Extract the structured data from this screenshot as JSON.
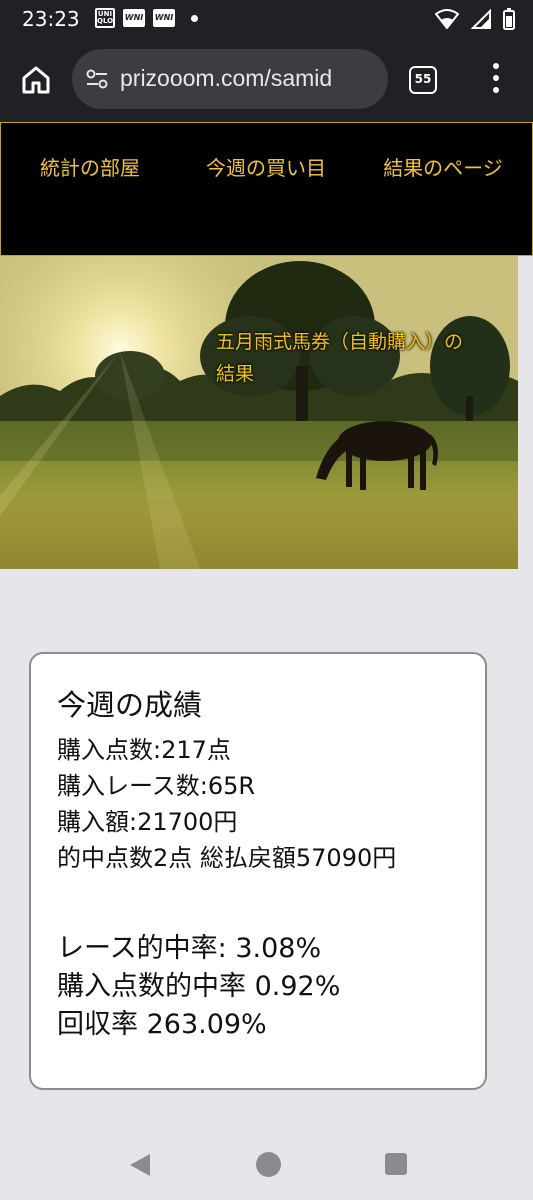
{
  "status_bar": {
    "time": "23:23",
    "uniqlo_badge": "UNI QLO",
    "wnl_badge_1": "WNI",
    "wnl_badge_2": "WNI"
  },
  "browser": {
    "url": "prizooom.com/samid",
    "tab_count": "55"
  },
  "nav": {
    "items": [
      {
        "label": "統計の部屋"
      },
      {
        "label": "今週の買い目"
      },
      {
        "label": "結果のページ"
      }
    ],
    "accent_color": "#f0c23a"
  },
  "hero": {
    "title": "五月雨式馬券（自動購入）の結果"
  },
  "results": {
    "heading": "今週の成績",
    "purchased_points": "購入点数:217点",
    "purchased_races": "購入レース数:65R",
    "purchase_amount": "購入額:21700円",
    "hits_and_payout": "的中点数2点 総払戻額57090円",
    "race_hit_rate": "レース的中率: 3.08%",
    "point_hit_rate": "購入点数的中率 0.92%",
    "return_rate": "回収率 263.09%"
  }
}
